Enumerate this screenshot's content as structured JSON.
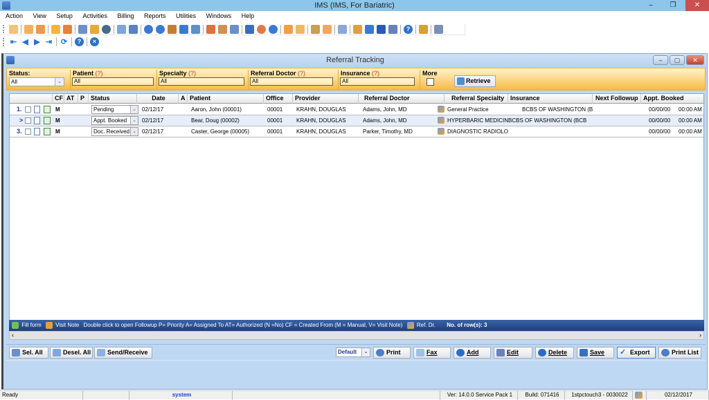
{
  "window": {
    "title": "IMS (IMS, For Bariatric)",
    "controls": {
      "minimize": "–",
      "restore": "❐",
      "close": "✕"
    }
  },
  "menu": [
    "Action",
    "View",
    "Setup",
    "Activities",
    "Billing",
    "Reports",
    "Utilities",
    "Windows",
    "Help"
  ],
  "toolbar": {
    "row1_icons": [
      "patient-icon",
      "patient-edit-icon",
      "patient-check-icon",
      "folder-icon",
      "note-edit-icon",
      "rx-icon",
      "lab-flask-icon",
      "shield-icon",
      "document-icon",
      "form-icon",
      "dollar-icon",
      "billing-icon",
      "payment-icon",
      "claims-icon",
      "collection-icon",
      "calendar-icon",
      "scheduler-icon",
      "report-icon",
      "send-icon",
      "box-icon",
      "box2-icon",
      "chart-icon",
      "clipboard-icon",
      "bar-chart-icon",
      "profile-icon",
      "copy-icon",
      "transfer-icon",
      "export-icon",
      "word-icon",
      "task-icon",
      "help-icon",
      "lock-icon",
      "exit-icon"
    ],
    "row2_icons": [
      "first-icon",
      "prev-icon",
      "next-icon",
      "last-icon",
      "refresh-icon",
      "help-icon",
      "close-icon"
    ]
  },
  "child_window": {
    "title": "Referral Tracking"
  },
  "filters": {
    "status": {
      "label": "Status:",
      "value": "All"
    },
    "patient": {
      "label": "Patient",
      "hint": "(?)",
      "value": "All"
    },
    "specialty": {
      "label": "Specialty",
      "hint": "(?)",
      "value": "All"
    },
    "referral_doctor": {
      "label": "Referral Doctor",
      "hint": "(?)",
      "value": "All"
    },
    "insurance": {
      "label": "Insurance",
      "hint": "(?)",
      "value": "All"
    },
    "more": {
      "label": "More",
      "checked": false
    },
    "retrieve_label": "Retrieve"
  },
  "grid": {
    "columns": [
      "CF",
      "AT",
      "P",
      "Status",
      "Date",
      "A",
      "Patient",
      "Office",
      "Provider",
      "Referral Doctor",
      "Referral Specialty",
      "Insurance",
      "Next Followup",
      "Appt. Booked"
    ],
    "rows": [
      {
        "num": "1.",
        "cf": "M",
        "at": "",
        "p": "",
        "status": "Pending",
        "date": "02/12/17",
        "a": "",
        "patient": "Aaron, John (00001)",
        "office": "00001",
        "provider": "KRAHN, DOUGLAS",
        "referral_doctor": "Adams, John, MD",
        "specialty": "General Practice",
        "insurance": "BCBS OF WASHINGTON   (BCB",
        "next_followup": "",
        "appt_date": "00/00/00",
        "appt_time": "00:00 AM"
      },
      {
        "num": ">",
        "cf": "M",
        "at": "",
        "p": "",
        "status": "Appt. Booked",
        "date": "02/12/17",
        "a": "",
        "patient": "Bear, Doug (00002)",
        "office": "00001",
        "provider": "KRAHN, DOUGLAS",
        "referral_doctor": "Adams, John, MD",
        "specialty": "HYPERBARIC MEDICINI",
        "insurance": "BCBS OF WASHINGTON   (BCB",
        "next_followup": "",
        "appt_date": "00/00/00",
        "appt_time": "00:00 AM"
      },
      {
        "num": "3.",
        "cf": "M",
        "at": "",
        "p": "",
        "status": "Doc. Received",
        "date": "02/12/17",
        "a": "",
        "patient": "Caster, George (00005)",
        "office": "00001",
        "provider": "KRAHN, DOUGLAS",
        "referral_doctor": "Parker, Timothy, MD",
        "specialty": "DIAGNOSTIC RADIOLOI",
        "insurance": "",
        "next_followup": "",
        "appt_date": "00/00/00",
        "appt_time": "00:00 AM"
      }
    ]
  },
  "legend": {
    "fill_form": "Fill form",
    "visit_note": "Visit Note",
    "text": "Double click to open Followup  P= Priority  A= Assigned To  AT= Authorized (N =No)  CF = Created From (M = Manual, V= Visit Note)",
    "ref_dr": "Ref. Dr.",
    "row_count": "No. of row(s): 3"
  },
  "buttons": {
    "sel_all": "Sel. All",
    "desel_all": "Desel. All",
    "send_receive": "Send/Receive",
    "print_template": "Default",
    "print": "Print",
    "fax": "Fax",
    "add": "Add",
    "edit": "Edit",
    "delete": "Delete",
    "save": "Save",
    "export": "Export",
    "print_list": "Print List"
  },
  "statusbar": {
    "state": "Ready",
    "user": "system",
    "version": "Ver: 14.0.0 Service Pack 1",
    "build": "Build: 071416",
    "machine": "1stpctouch3 - 0030022",
    "date": "02/12/2017"
  }
}
